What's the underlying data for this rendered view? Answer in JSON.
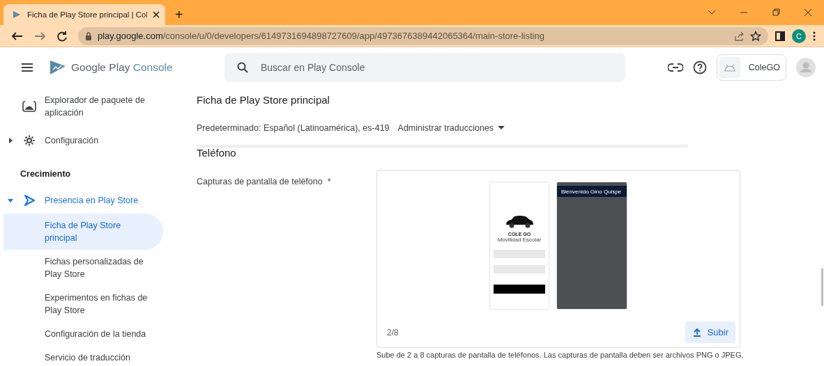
{
  "browser": {
    "tabs": [
      {
        "title": "Ficha de Play Store principal | Col",
        "selected": true
      }
    ],
    "new_tab": "+",
    "address": {
      "host": "play.google.com",
      "path": "/console/u/0/developers/6149731694898727609/app/4973676389442065364/main-store-listing"
    },
    "profile_letter": "C"
  },
  "header": {
    "logo_brand": "Google Play",
    "logo_product": "Console",
    "search": {
      "placeholder": "Buscar en Play Console"
    },
    "app_name": "ColeGO"
  },
  "sidebar": {
    "items": [
      {
        "kind": "item",
        "label": "Explorador de paquete de aplicación"
      },
      {
        "kind": "item",
        "label": "Configuración",
        "expanded": false
      },
      {
        "kind": "section",
        "label": "Crecimiento"
      },
      {
        "kind": "item",
        "label": "Presencia en Play Store",
        "expanded": true,
        "children": [
          {
            "label": "Ficha de Play Store principal",
            "selected": true
          },
          {
            "label": "Fichas personalizadas de Play Store",
            "selected": false
          },
          {
            "label": "Experimentos en fichas de Play Store",
            "selected": false
          },
          {
            "label": "Configuración de la tienda",
            "selected": false
          },
          {
            "label": "Servicio de traducción",
            "selected": false
          }
        ]
      }
    ]
  },
  "content": {
    "title": "Ficha de Play Store principal",
    "default_language": "Predeterminado: Español (Latinoamérica), es-419",
    "manage_translations": "Administrar traducciones",
    "section": "Teléfono",
    "field": {
      "label": "Capturas de pantalla de teléfono",
      "required_mark": "*",
      "screenshots": [
        {
          "kind": "login",
          "app_title": "COLE GO",
          "app_subtitle": "Movilidad Escolar"
        },
        {
          "kind": "home",
          "header": "Bienvenido Gino Quispe"
        }
      ],
      "counter": "2/8",
      "upload": "Subir",
      "help": "Sube de 2 a 8 capturas de pantalla de teléfonos. Las capturas de pantalla deben ser archivos PNG o JPEG,"
    }
  }
}
